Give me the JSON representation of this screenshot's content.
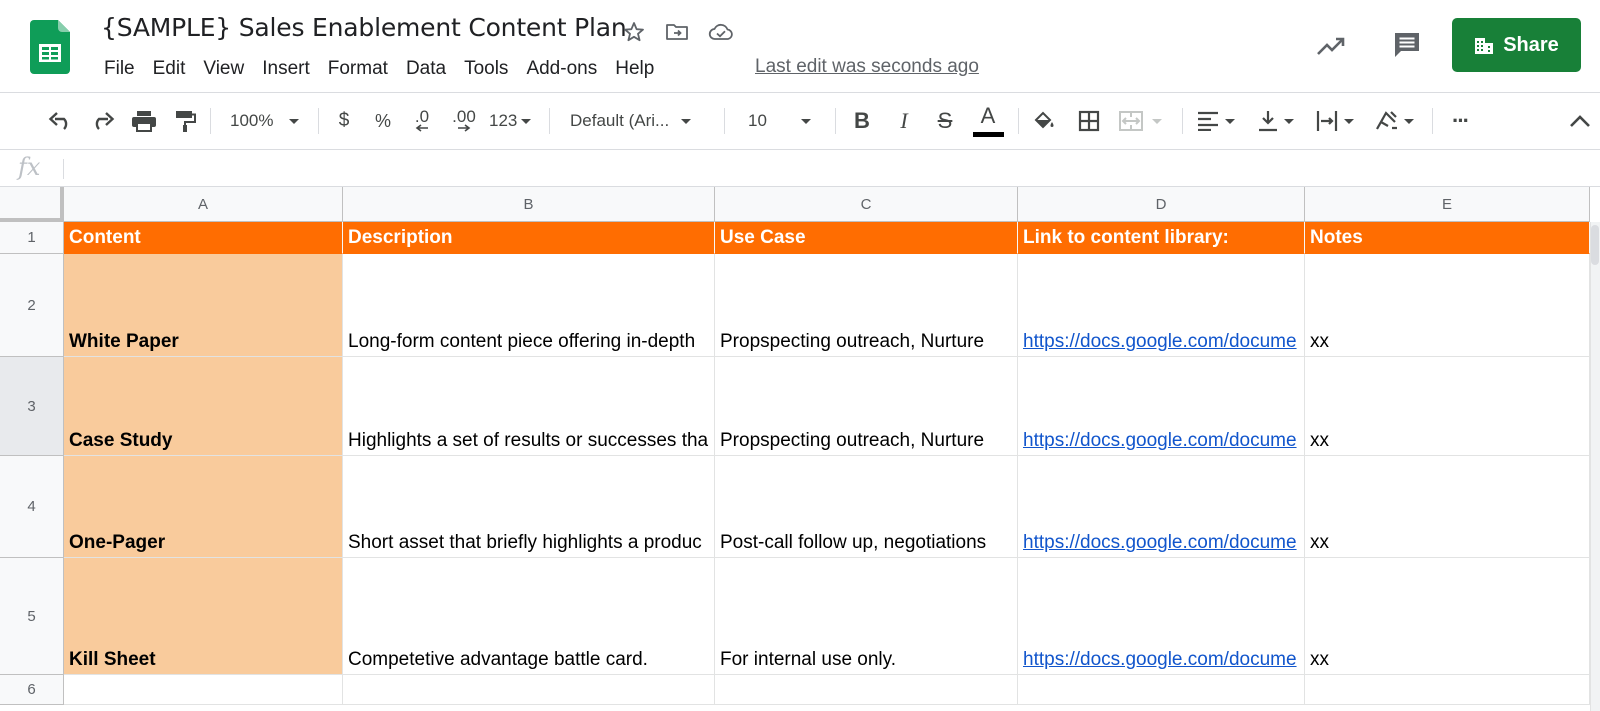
{
  "app": {
    "document_title": "{SAMPLE} Sales Enablement Content Plan",
    "last_edit": "Last edit was seconds ago",
    "share_label": "Share",
    "brand_color": "#188038",
    "menu": [
      "File",
      "Edit",
      "View",
      "Insert",
      "Format",
      "Data",
      "Tools",
      "Add-ons",
      "Help"
    ]
  },
  "toolbar": {
    "zoom": "100%",
    "currency": "$",
    "percent": "%",
    "decrease_decimal": ".0",
    "increase_decimal": ".00",
    "number_format": "123",
    "font_family": "Default (Ari...",
    "font_size": "10",
    "bold": "B",
    "italic": "I",
    "strikethrough": "S",
    "text_color": "A",
    "more": "···"
  },
  "formula_bar": {
    "fx_label": "fx",
    "value": ""
  },
  "sheet": {
    "columns": [
      "A",
      "B",
      "C",
      "D",
      "E"
    ],
    "row_numbers": [
      "1",
      "2",
      "3",
      "4",
      "5",
      "6"
    ],
    "header": [
      "Content",
      "Description",
      "Use Case",
      "Link to content library:",
      "Notes"
    ],
    "header_color": "#ff6d01",
    "content_color": "#f9cb9c",
    "rows": [
      {
        "content": "White Paper",
        "description": "Long-form content piece offering in-depth",
        "use_case": "Propspecting outreach, Nurture",
        "link": "https://docs.google.com/docume",
        "notes": "xx"
      },
      {
        "content": "Case Study",
        "description": "Highlights a set of results or successes tha",
        "use_case": "Propspecting outreach, Nurture",
        "link": "https://docs.google.com/docume",
        "notes": "xx"
      },
      {
        "content": "One-Pager",
        "description": "Short asset that briefly highlights a produc",
        "use_case": "Post-call follow up, negotiations",
        "link": "https://docs.google.com/docume",
        "notes": "xx"
      },
      {
        "content": "Kill Sheet",
        "description": "Competetive advantage battle card.",
        "use_case": "For internal use only.",
        "link": "https://docs.google.com/docume",
        "notes": "xx"
      }
    ]
  },
  "icons": {
    "logo": "sheets-logo-icon",
    "star": "star-icon",
    "move": "move-to-folder-icon",
    "cloud": "cloud-saved-icon",
    "activity": "activity-trend-icon",
    "comments": "comments-icon"
  }
}
